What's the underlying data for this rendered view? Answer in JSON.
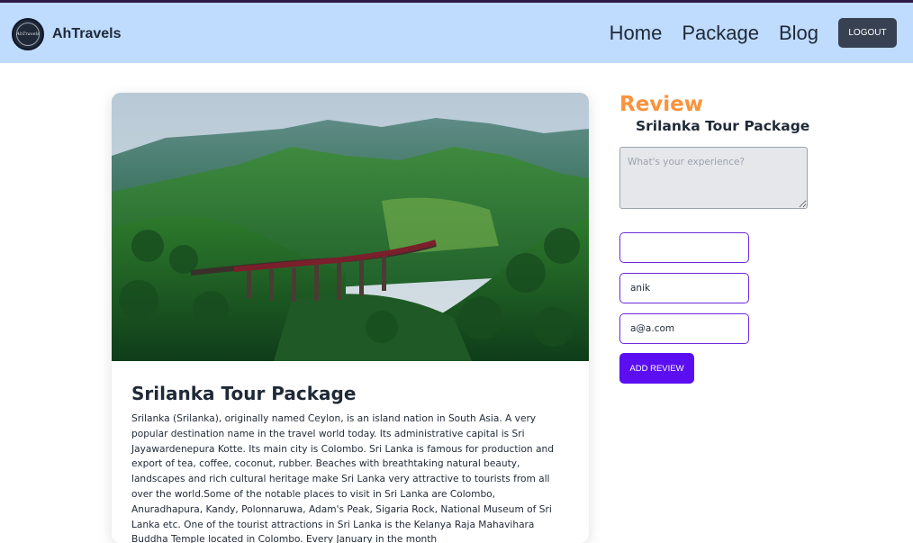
{
  "brand": {
    "name": "AhTravels",
    "logo_text": "AhTravels"
  },
  "nav": {
    "links": [
      "Home",
      "Package",
      "Blog"
    ],
    "logout_label": "Logout"
  },
  "package": {
    "title": "Srilanka Tour Package",
    "description": "Srilanka (Srilanka), originally named Ceylon, is an island nation in South Asia. A very popular destination name in the travel world today. Its administrative capital is Sri Jayawardenepura Kotte. Its main city is Colombo. Sri Lanka is famous for production and export of tea, coffee, coconut, rubber. Beaches with breathtaking natural beauty, landscapes and rich cultural heritage make Sri Lanka very attractive to tourists from all over the world.Some of the notable places to visit in Sri Lanka are Colombo, Anuradhapura, Kandy, Polonnaruwa, Adam's Peak, Sigaria Rock, National Museum of Sri Lanka etc. One of the tourist attractions in Sri Lanka is the Kelanya Raja Mahavihara Buddha Temple located in Colombo. Every January in the month"
  },
  "review": {
    "heading": "Review",
    "package_name": "Srilanka Tour Package",
    "experience_placeholder": "What's your experience?",
    "field1_value": "",
    "name_value": "anik",
    "email_value": "a@a.com",
    "submit_label": "Add Review"
  },
  "colors": {
    "navbar_bg": "#bfdbfe",
    "review_heading": "#fb923c",
    "submit_bg": "#5b0ff0",
    "input_border": "#6d28d9",
    "logout_bg": "#374151"
  }
}
